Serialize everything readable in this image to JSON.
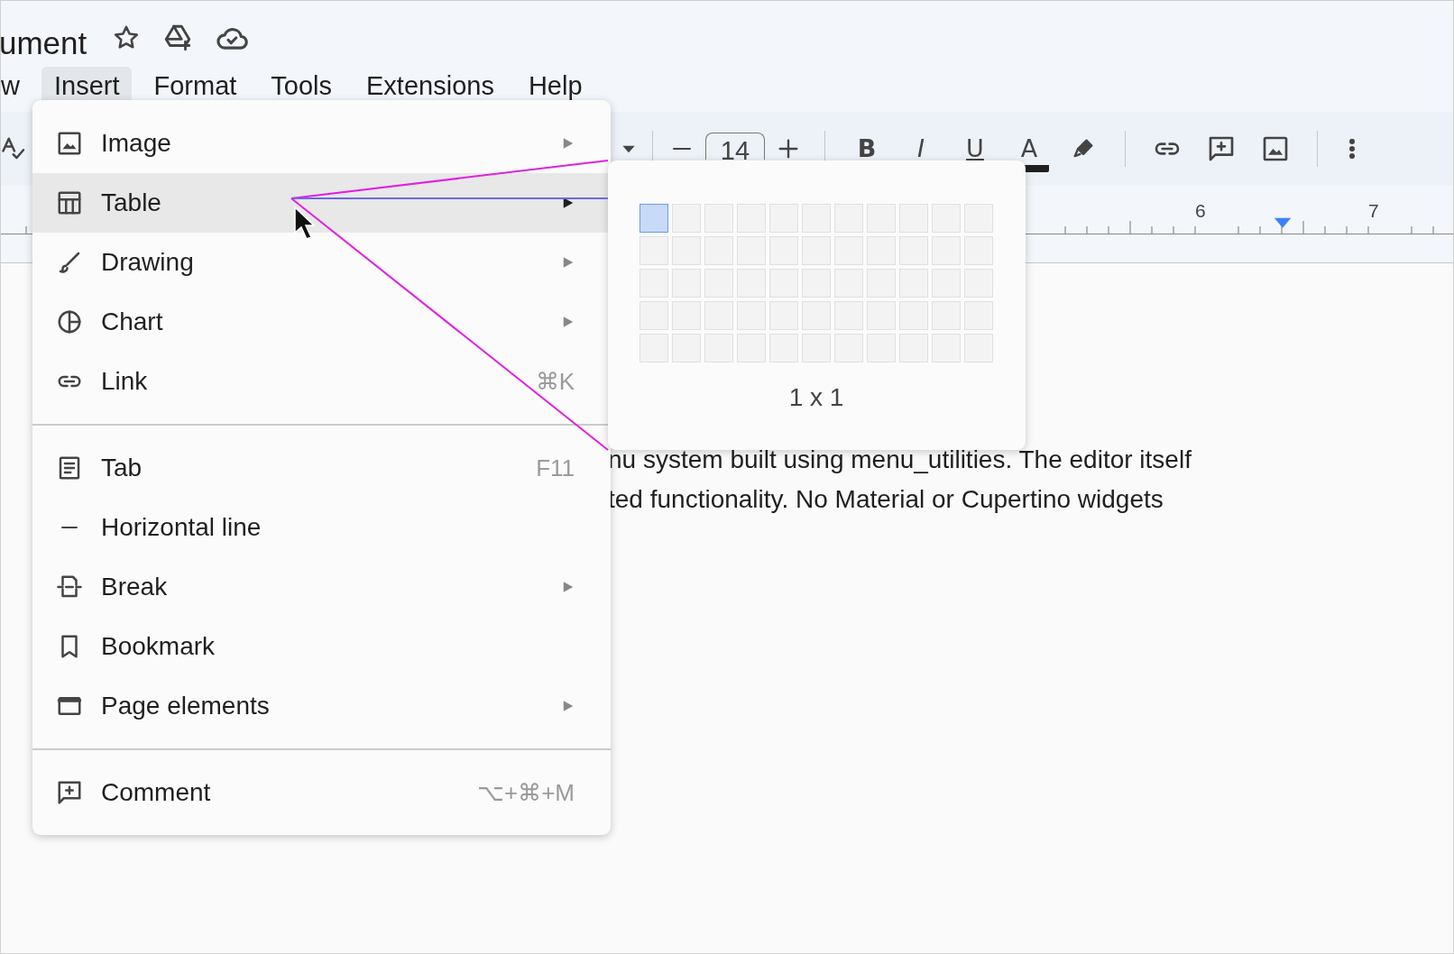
{
  "document_title": "ument",
  "menubar": [
    {
      "label": "w",
      "selected": false
    },
    {
      "label": "Insert",
      "selected": true
    },
    {
      "label": "Format",
      "selected": false
    },
    {
      "label": "Tools",
      "selected": false
    },
    {
      "label": "Extensions",
      "selected": false
    },
    {
      "label": "Help",
      "selected": false
    }
  ],
  "toolbar": {
    "font_size": "14",
    "format_buttons": [
      "B",
      "I",
      "U",
      "A"
    ]
  },
  "ruler": {
    "labels": [
      "6",
      "7"
    ]
  },
  "document": {
    "lines": [
      "nu system built using menu_utilities. The editor itself",
      "ted functionality. No Material or Cupertino widgets"
    ]
  },
  "insert_menu": {
    "items": [
      {
        "kind": "item",
        "label": "Image",
        "submenu": true,
        "selected": false
      },
      {
        "kind": "item",
        "label": "Table",
        "submenu": true,
        "selected": true
      },
      {
        "kind": "item",
        "label": "Drawing",
        "submenu": true,
        "selected": false
      },
      {
        "kind": "item",
        "label": "Chart",
        "submenu": true,
        "selected": false
      },
      {
        "kind": "item",
        "label": "Link",
        "shortcut": "⌘K",
        "submenu": false,
        "selected": false
      },
      {
        "kind": "separator"
      },
      {
        "kind": "item",
        "label": "Tab",
        "shortcut": "F11",
        "submenu": false,
        "selected": false
      },
      {
        "kind": "item",
        "label": "Horizontal line",
        "submenu": false,
        "selected": false
      },
      {
        "kind": "item",
        "label": "Break",
        "submenu": true,
        "selected": false
      },
      {
        "kind": "item",
        "label": "Bookmark",
        "submenu": false,
        "selected": false
      },
      {
        "kind": "item",
        "label": "Page elements",
        "submenu": true,
        "selected": false
      },
      {
        "kind": "separator"
      },
      {
        "kind": "item",
        "label": "Comment",
        "shortcut": "⌥+⌘+M",
        "submenu": false,
        "selected": false
      }
    ]
  },
  "table_picker": {
    "size_label": "1 x 1",
    "rows": [
      [
        {
          "selected": true
        },
        {
          "selected": false
        },
        {
          "selected": false
        },
        {
          "selected": false
        },
        {
          "selected": false
        },
        {
          "selected": false
        },
        {
          "selected": false
        },
        {
          "selected": false
        },
        {
          "selected": false
        },
        {
          "selected": false
        },
        {
          "selected": false
        }
      ],
      [
        {
          "selected": false
        },
        {
          "selected": false
        },
        {
          "selected": false
        },
        {
          "selected": false
        },
        {
          "selected": false
        },
        {
          "selected": false
        },
        {
          "selected": false
        },
        {
          "selected": false
        },
        {
          "selected": false
        },
        {
          "selected": false
        },
        {
          "selected": false
        }
      ],
      [
        {
          "selected": false
        },
        {
          "selected": false
        },
        {
          "selected": false
        },
        {
          "selected": false
        },
        {
          "selected": false
        },
        {
          "selected": false
        },
        {
          "selected": false
        },
        {
          "selected": false
        },
        {
          "selected": false
        },
        {
          "selected": false
        },
        {
          "selected": false
        }
      ],
      [
        {
          "selected": false
        },
        {
          "selected": false
        },
        {
          "selected": false
        },
        {
          "selected": false
        },
        {
          "selected": false
        },
        {
          "selected": false
        },
        {
          "selected": false
        },
        {
          "selected": false
        },
        {
          "selected": false
        },
        {
          "selected": false
        },
        {
          "selected": false
        }
      ],
      [
        {
          "selected": false
        },
        {
          "selected": false
        },
        {
          "selected": false
        },
        {
          "selected": false
        },
        {
          "selected": false
        },
        {
          "selected": false
        },
        {
          "selected": false
        },
        {
          "selected": false
        },
        {
          "selected": false
        },
        {
          "selected": false
        },
        {
          "selected": false
        }
      ]
    ]
  }
}
